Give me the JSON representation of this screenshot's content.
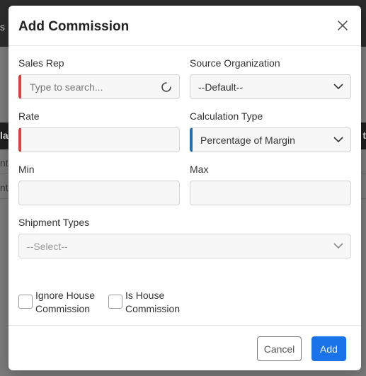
{
  "background": {
    "topbar_fragment": "s",
    "header_left_fragment": "la",
    "header_right_fragment": "t",
    "row1_fragment": "nt",
    "row2_fragment": "nt"
  },
  "modal": {
    "title": "Add Commission",
    "fields": {
      "sales_rep": {
        "label": "Sales Rep",
        "placeholder": "Type to search..."
      },
      "source_org": {
        "label": "Source Organization",
        "value": "--Default--"
      },
      "rate": {
        "label": "Rate",
        "value": ""
      },
      "calc_type": {
        "label": "Calculation Type",
        "value": "Percentage of Margin"
      },
      "min": {
        "label": "Min",
        "value": ""
      },
      "max": {
        "label": "Max",
        "value": ""
      },
      "shipment_types": {
        "label": "Shipment Types",
        "placeholder": "--Select--"
      }
    },
    "checkboxes": {
      "ignore_house": {
        "line1": "Ignore House",
        "line2": "Commission",
        "checked": false
      },
      "is_house": {
        "line1": "Is House",
        "line2": "Commission",
        "checked": false
      }
    },
    "footer": {
      "cancel_label": "Cancel",
      "add_label": "Add"
    }
  },
  "colors": {
    "required_accent": "#e0413f",
    "info_accent": "#1f6fb2",
    "primary": "#1a73e8"
  }
}
